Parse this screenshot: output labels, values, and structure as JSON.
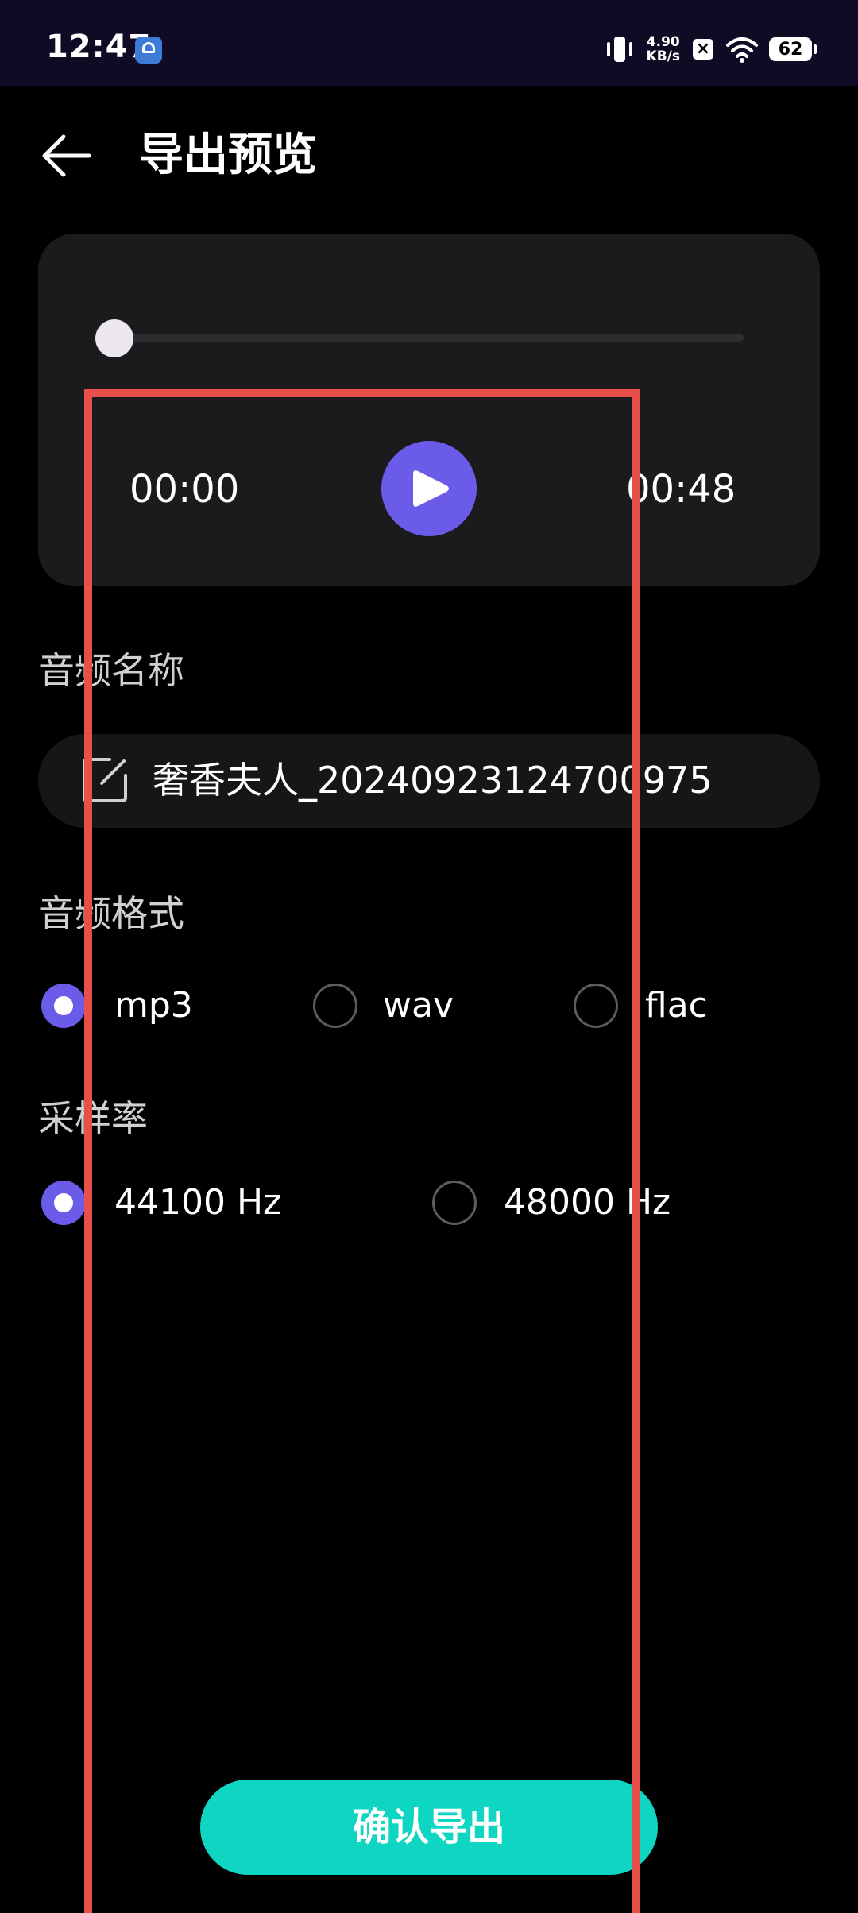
{
  "status_bar": {
    "time": "12:47",
    "net_speed_value": "4.90",
    "net_speed_unit": "KB/s",
    "battery": "62"
  },
  "header": {
    "title": "导出预览"
  },
  "player": {
    "current_time": "00:00",
    "total_time": "00:48",
    "progress": 0
  },
  "audio_name": {
    "label": "音频名称",
    "value": "奢香夫人_20240923124700975"
  },
  "audio_format": {
    "label": "音频格式",
    "options": [
      {
        "label": "mp3",
        "selected": true
      },
      {
        "label": "wav",
        "selected": false
      },
      {
        "label": "flac",
        "selected": false
      }
    ]
  },
  "sample_rate": {
    "label": "采样率",
    "options": [
      {
        "label": "44100 Hz",
        "selected": true
      },
      {
        "label": "48000 Hz",
        "selected": false
      }
    ]
  },
  "confirm_label": "确认导出",
  "colors": {
    "accent": "#6a5ce8",
    "confirm": "#0fd6c2",
    "highlight": "#e94f4a"
  }
}
